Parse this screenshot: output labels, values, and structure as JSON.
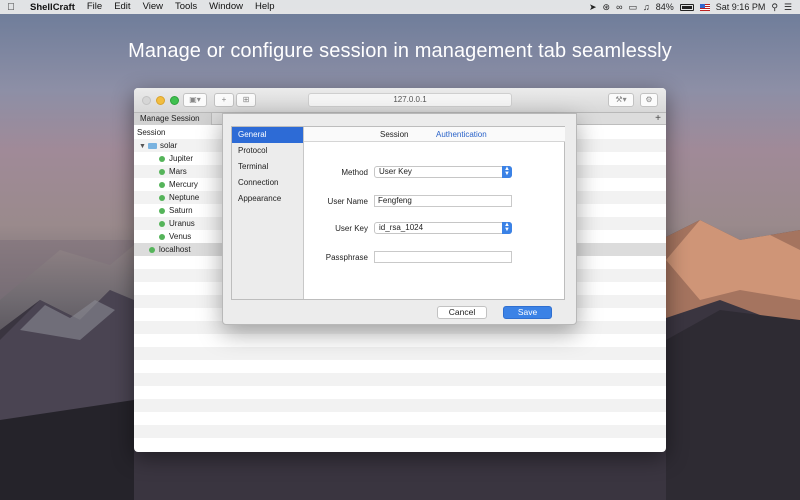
{
  "menubar": {
    "app_name": "ShellCraft",
    "menus": [
      "File",
      "Edit",
      "View",
      "Tools",
      "Window",
      "Help"
    ],
    "battery_percent": "84%",
    "clock": "Sat 9:16 PM"
  },
  "headline": "Manage or configure session in management tab seamlessly",
  "window": {
    "address": "127.0.0.1",
    "tab_label": "Manage Session",
    "add_tab": "+",
    "list_header": "Session",
    "folder": "solar",
    "items": [
      "Jupiter",
      "Mars",
      "Mercury",
      "Neptune",
      "Saturn",
      "Uranus",
      "Venus"
    ],
    "localhost": "localhost"
  },
  "dialog": {
    "categories": [
      "General",
      "Protocol",
      "Terminal",
      "Connection",
      "Appearance"
    ],
    "tabs": {
      "session": "Session",
      "authentication": "Authentication"
    },
    "fields": {
      "method_label": "Method",
      "method_value": "User Key",
      "username_label": "User Name",
      "username_value": "Fengfeng",
      "userkey_label": "User Key",
      "userkey_value": "id_rsa_1024",
      "passphrase_label": "Passphrase",
      "passphrase_value": ""
    },
    "cancel_label": "Cancel",
    "save_label": "Save"
  },
  "colors": {
    "accent": "#3b82e6",
    "selection": "#2d6bd6",
    "status_online": "#55b45a"
  }
}
